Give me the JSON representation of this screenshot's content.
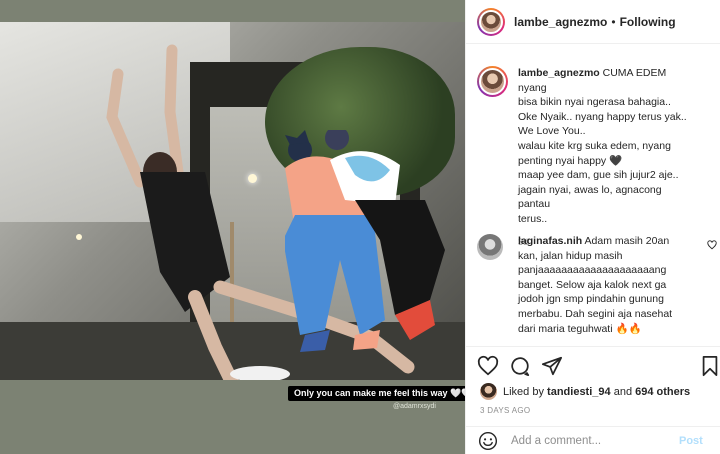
{
  "post": {
    "sticker_text": "Only you can make me feel this way 🤍🤍",
    "sticker_handle": "@adamrxsydi"
  },
  "header": {
    "username": "lambe_agnezmo",
    "separator": "•",
    "follow_label": "Following"
  },
  "caption": {
    "username": "lambe_agnezmo",
    "lines": [
      "CUMA EDEM nyang",
      "bisa bikin nyai ngerasa bahagia..",
      "Oke Nyaik.. nyang happy terus yak..",
      "We Love You..",
      "walau kite krg suka edem, nyang",
      "penting nyai happy 🖤",
      "maap yee dam, gue sih jujur2 aje..",
      "jagain nyai, awas lo, agnacong pantau",
      "terus.."
    ],
    "time": "3d"
  },
  "comment": {
    "username": "laginafas.nih",
    "lines": [
      "Adam masih 20an",
      "kan, jalan hidup masih",
      "panjaaaaaaaaaaaaaaaaaaaang",
      "banget. Selow aja kalok next ga",
      "jodoh jgn smp pindahin gunung",
      "merbabu. Dah segini aja nasehat",
      "dari maria teguhwati 🔥🔥"
    ]
  },
  "likes": {
    "prefix": "Liked by",
    "user": "tandiesti_94",
    "middle": "and",
    "count": "694 others"
  },
  "date": "3 DAYS AGO",
  "add_comment": {
    "placeholder": "Add a comment...",
    "post_label": "Post"
  },
  "colors": {
    "accent": "#262626",
    "post_disabled": "#b2dffc",
    "muted": "#8e8e8e",
    "media_bg": "#7c8273"
  },
  "icons": [
    "heart-icon",
    "comment-icon",
    "share-icon",
    "bookmark-icon",
    "smile-icon",
    "small-heart-icon"
  ]
}
